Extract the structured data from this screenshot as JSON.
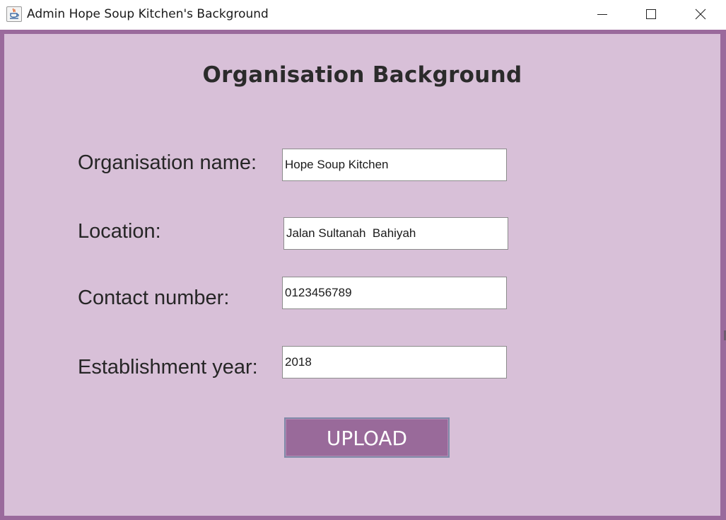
{
  "window": {
    "title": "Admin Hope Soup Kitchen's Background",
    "app_icon": "java-cup-icon",
    "controls": [
      "minimize-icon",
      "maximize-icon",
      "close-icon"
    ]
  },
  "form": {
    "heading": "Organisation Background",
    "fields": [
      {
        "label": "Organisation name:",
        "value": "Hope Soup Kitchen"
      },
      {
        "label": "Location:",
        "value": "Jalan Sultanah  Bahiyah"
      },
      {
        "label": "Contact number:",
        "value": "0123456789"
      },
      {
        "label": "Establishment year:",
        "value": "2018"
      }
    ],
    "upload_label": "UPLOAD"
  },
  "colors": {
    "frame": "#9a6a9c",
    "panel": "#d8c0d8",
    "button": "#996a9a",
    "button_text": "#ffffff"
  }
}
